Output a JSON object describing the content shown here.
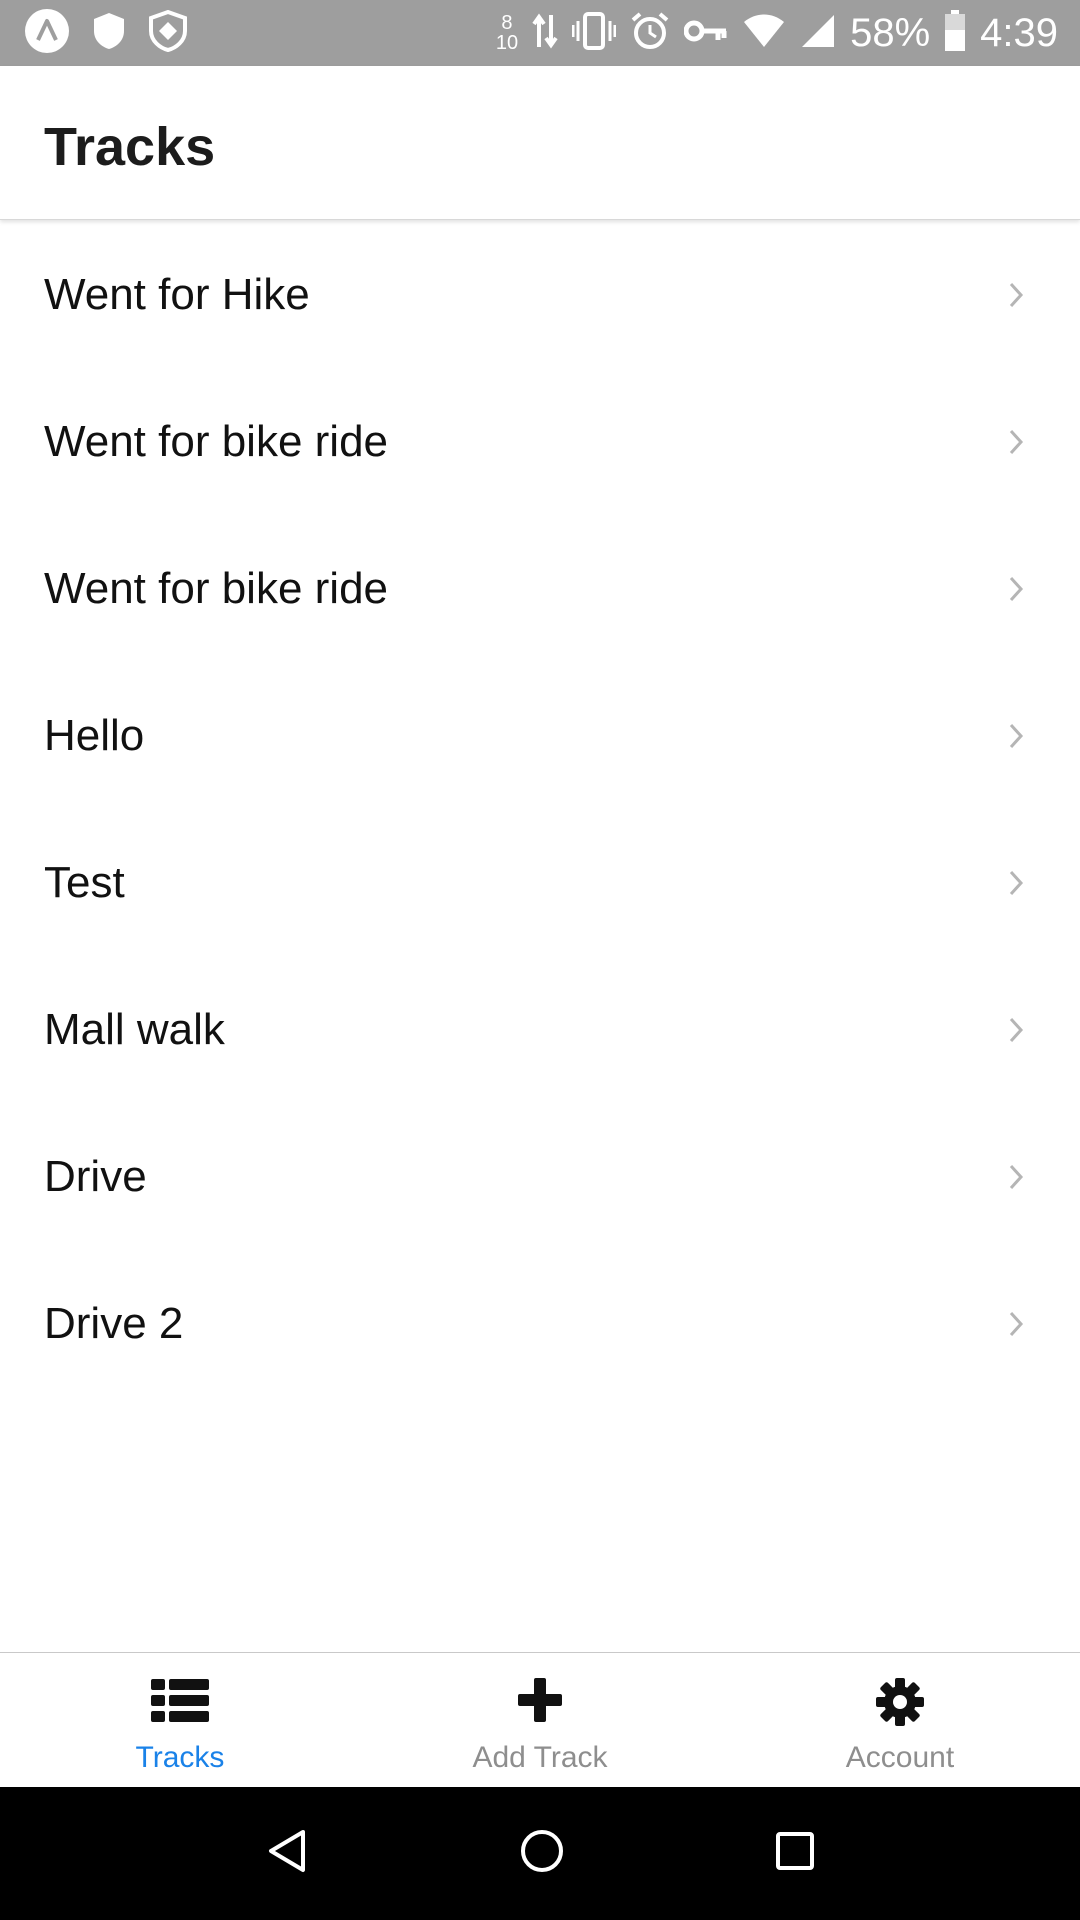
{
  "status_bar": {
    "net_up": "8",
    "net_down": "10",
    "battery": "58%",
    "time": "4:39",
    "icons": [
      "app-a-icon",
      "shield-icon",
      "shield-check-icon",
      "data-arrows-icon",
      "vibrate-icon",
      "alarm-icon",
      "vpn-key-icon",
      "wifi-icon",
      "signal-icon",
      "battery-icon"
    ]
  },
  "header": {
    "title": "Tracks"
  },
  "tracks": [
    {
      "label": "Went for Hike"
    },
    {
      "label": "Went for bike ride"
    },
    {
      "label": "Went for bike ride"
    },
    {
      "label": "Hello"
    },
    {
      "label": "Test"
    },
    {
      "label": "Mall walk"
    },
    {
      "label": "Drive"
    },
    {
      "label": "Drive 2"
    }
  ],
  "tab_bar": {
    "tracks_label": "Tracks",
    "add_track_label": "Add Track",
    "account_label": "Account",
    "active_color": "#1a82e8",
    "inactive_color": "#8e8e8e"
  },
  "nav_bar": {
    "icons": [
      "back-icon",
      "home-icon",
      "recents-icon"
    ]
  }
}
